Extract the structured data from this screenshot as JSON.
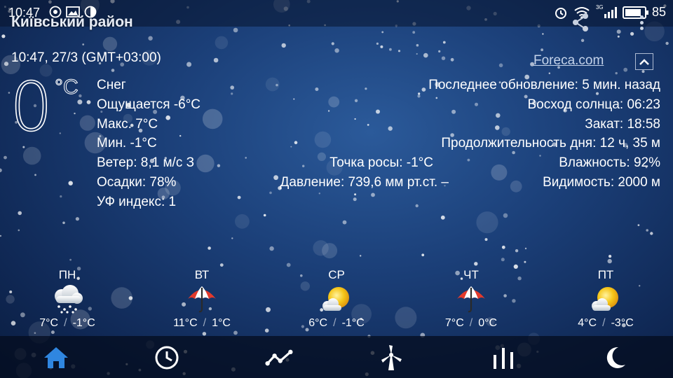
{
  "status_bar": {
    "time": "10:47",
    "signal_label": "3G",
    "battery": "85",
    "icons": [
      "whatsapp-icon",
      "image-icon",
      "sync-icon",
      "alarm-icon",
      "wifi-icon",
      "signal-icon",
      "battery-icon"
    ]
  },
  "header": {
    "location": "Київський район",
    "datetime": "10:47, 27/3 (GMT+03:00)",
    "provider_link": "Foreca.com"
  },
  "current": {
    "temperature": "0",
    "unit": "°C",
    "condition": "Снег",
    "feels_like": "Ощущается -6°C",
    "max": "Макс. 7°C",
    "min": "Мин. -1°C",
    "wind": "Ветер: 8,1 м/с З",
    "precipitation": "Осадки: 78%",
    "uv": "УФ индекс: 1"
  },
  "middle": {
    "dew_point": "Точка росы: -1°C",
    "pressure": "Давление: 739,6 мм рт.ст. –"
  },
  "right": {
    "last_update": "Последнее обновление: 5 мин. назад",
    "sunrise": "Восход солнца: 06:23",
    "sunset": "Закат: 18:58",
    "day_length": "Продолжительность дня: 12 ч, 35 м",
    "humidity": "Влажность: 92%",
    "visibility": "Видимость: 2000 м"
  },
  "forecast": [
    {
      "day": "ПН",
      "icon": "snow-cloud-icon",
      "high": "7°C",
      "low": "-1°C"
    },
    {
      "day": "ВТ",
      "icon": "umbrella-icon",
      "high": "11°C",
      "low": "1°C"
    },
    {
      "day": "СР",
      "icon": "sun-cloud-icon",
      "high": "6°C",
      "low": "-1°C"
    },
    {
      "day": "ЧТ",
      "icon": "umbrella-icon",
      "high": "7°C",
      "low": "0°C"
    },
    {
      "day": "ПТ",
      "icon": "sun-cloud-icon",
      "high": "4°C",
      "low": "-3°C"
    }
  ],
  "nav": {
    "items": [
      "home-icon",
      "clock-icon",
      "trend-icon",
      "wind-turbine-icon",
      "bar-chart-icon",
      "moon-icon"
    ],
    "active": "home-icon"
  },
  "colors": {
    "background": "#1b3f78",
    "nav_active": "#2f86e0",
    "nav_inactive": "#ffffff"
  }
}
